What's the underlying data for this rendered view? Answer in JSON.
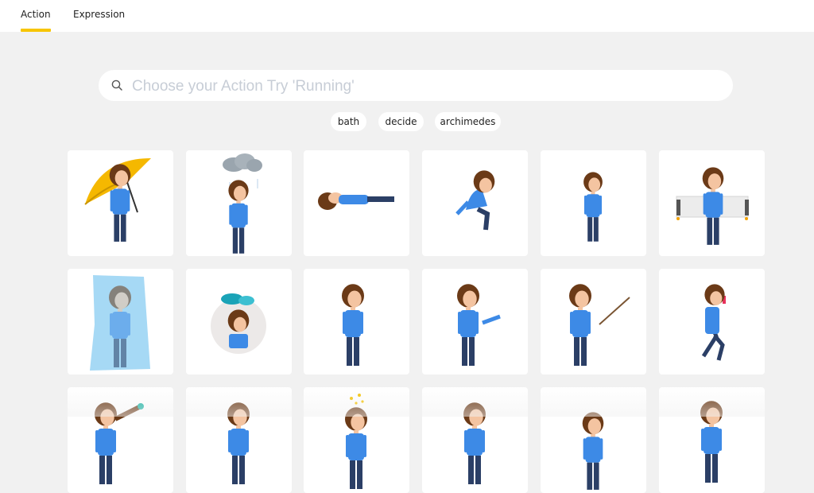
{
  "tabs": [
    {
      "label": "Action",
      "active": true
    },
    {
      "label": "Expression",
      "active": false
    }
  ],
  "search": {
    "placeholder": "Choose your Action Try 'Running'",
    "value": "",
    "icon": "search-icon"
  },
  "suggestions": [
    "bath",
    "decide",
    "archimedes"
  ],
  "accent_color": "#f7c500",
  "cards": [
    {
      "name": "umbrella"
    },
    {
      "name": "rain-cloud"
    },
    {
      "name": "lying-down"
    },
    {
      "name": "bending-forward"
    },
    {
      "name": "standing-sad"
    },
    {
      "name": "jetpack"
    },
    {
      "name": "frozen"
    },
    {
      "name": "gloomy-cloud-avatar"
    },
    {
      "name": "side-standing"
    },
    {
      "name": "pointing"
    },
    {
      "name": "presenting-stick"
    },
    {
      "name": "running-whistle"
    },
    {
      "name": "telescope"
    },
    {
      "name": "side-profile"
    },
    {
      "name": "sparkle-idea"
    },
    {
      "name": "standing-front"
    },
    {
      "name": "standing-small"
    },
    {
      "name": "side-looking"
    }
  ]
}
